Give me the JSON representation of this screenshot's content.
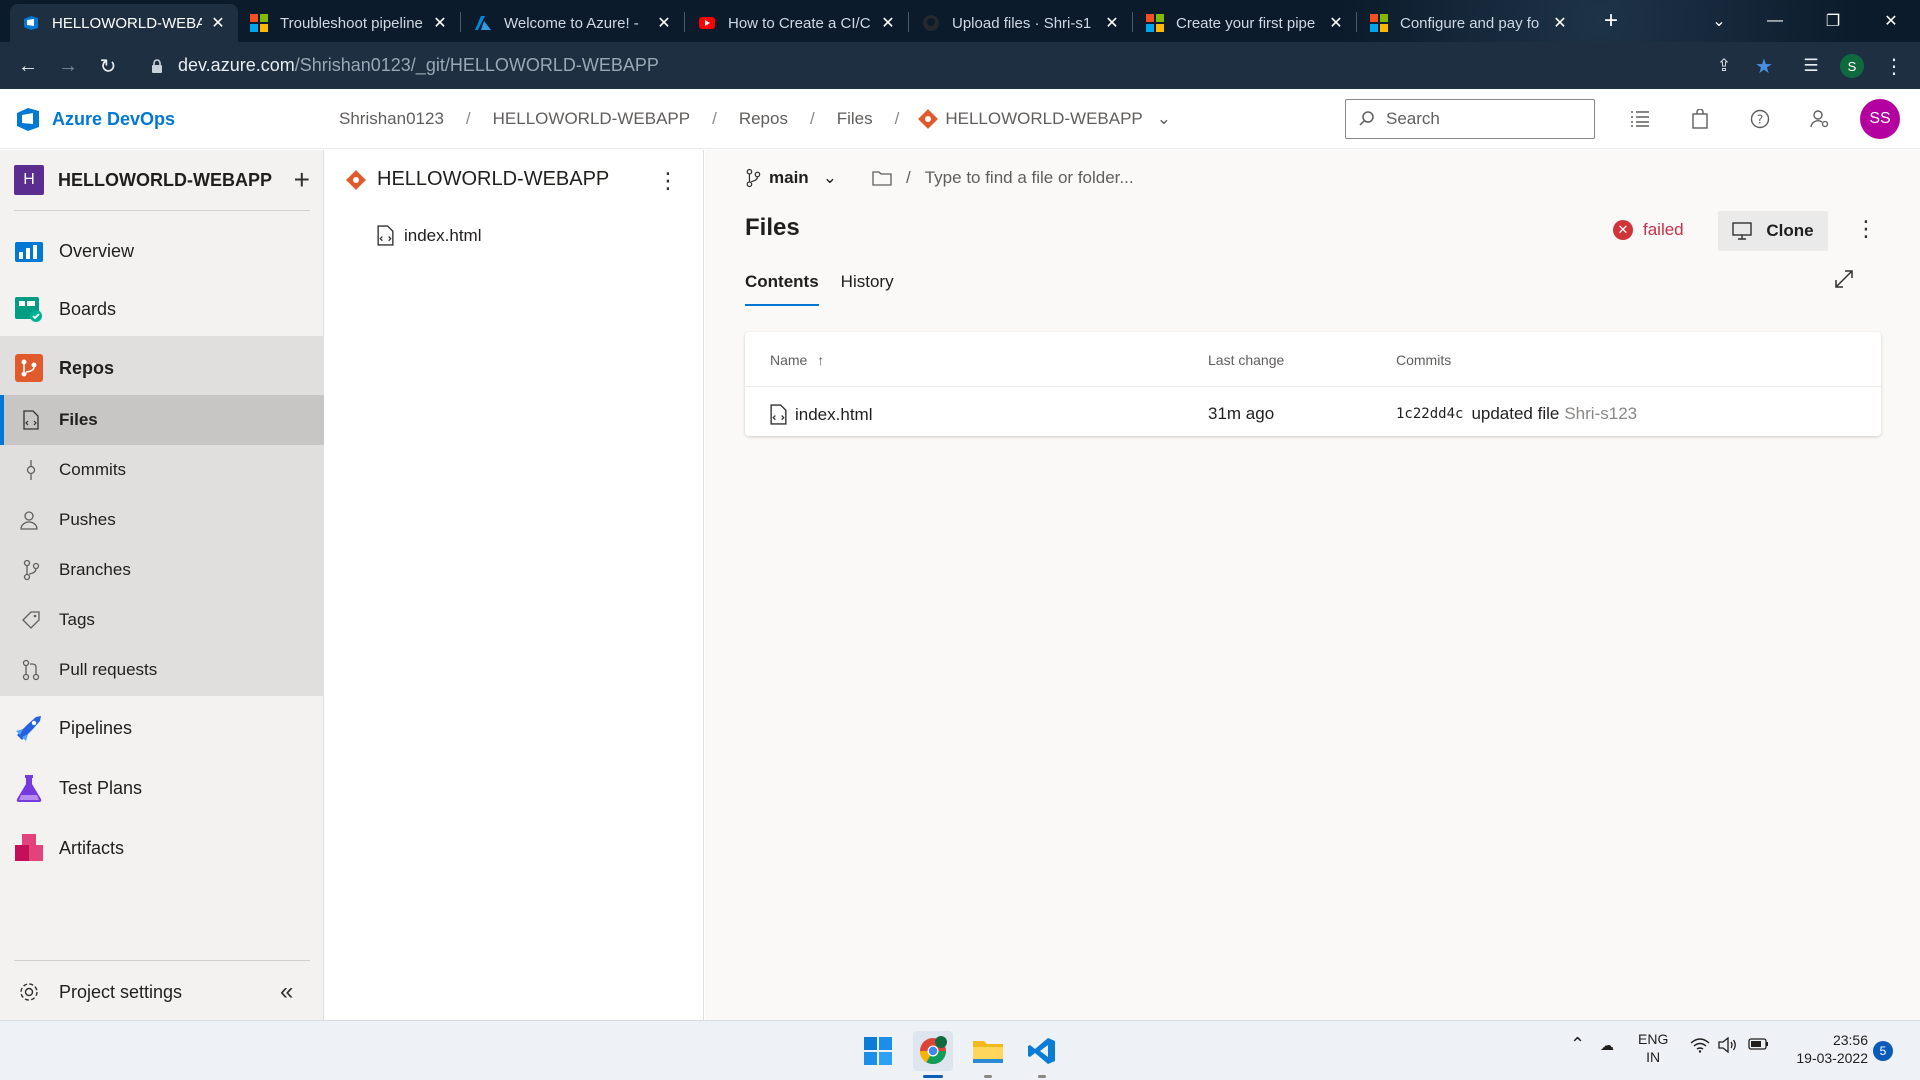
{
  "browser": {
    "tabs": [
      {
        "title": "HELLOWORLD-WEBAPP",
        "icon": "azure-devops-icon"
      },
      {
        "title": "Troubleshoot pipeline",
        "icon": "microsoft-icon"
      },
      {
        "title": "Welcome to Azure! - ",
        "icon": "azure-icon"
      },
      {
        "title": "How to Create a CI/C",
        "icon": "youtube-icon"
      },
      {
        "title": "Upload files · Shri-s1",
        "icon": "github-icon"
      },
      {
        "title": "Create your first pipe",
        "icon": "microsoft-icon"
      },
      {
        "title": "Configure and pay fo",
        "icon": "microsoft-icon"
      }
    ],
    "url_host": "dev.azure.com",
    "url_path": "/Shrishan0123/_git/HELLOWORLD-WEBAPP",
    "profile_initial": "S"
  },
  "header": {
    "product": "Azure DevOps",
    "breadcrumb": [
      "Shrishan0123",
      "HELLOWORLD-WEBAPP",
      "Repos",
      "Files",
      "HELLOWORLD-WEBAPP"
    ],
    "search_placeholder": "Search",
    "avatar_initials": "SS"
  },
  "sidebar": {
    "project_initial": "H",
    "project_name": "HELLOWORLD-WEBAPP",
    "items": [
      {
        "label": "Overview"
      },
      {
        "label": "Boards"
      },
      {
        "label": "Repos"
      },
      {
        "label": "Files"
      },
      {
        "label": "Commits"
      },
      {
        "label": "Pushes"
      },
      {
        "label": "Branches"
      },
      {
        "label": "Tags"
      },
      {
        "label": "Pull requests"
      },
      {
        "label": "Pipelines"
      },
      {
        "label": "Test Plans"
      },
      {
        "label": "Artifacts"
      }
    ],
    "settings_label": "Project settings"
  },
  "tree": {
    "repo_name": "HELLOWORLD-WEBAPP",
    "files": [
      "index.html"
    ]
  },
  "main": {
    "branch": "main",
    "path_placeholder": "Type to find a file or folder...",
    "title": "Files",
    "status": "failed",
    "clone_label": "Clone",
    "tabs": [
      "Contents",
      "History"
    ],
    "columns": [
      "Name",
      "Last change",
      "Commits"
    ],
    "rows": [
      {
        "name": "index.html",
        "last_change": "31m ago",
        "commit_id": "1c22dd4c",
        "commit_message": "updated file",
        "author": "Shri-s123"
      }
    ]
  },
  "taskbar": {
    "lang": "ENG",
    "region": "IN",
    "time": "23:56",
    "date": "19-03-2022",
    "notifications": "5"
  },
  "colors": {
    "accent": "#0078d4",
    "failed": "#d13438",
    "avatar": "#b4009e",
    "project_badge": "#5c2d91"
  }
}
